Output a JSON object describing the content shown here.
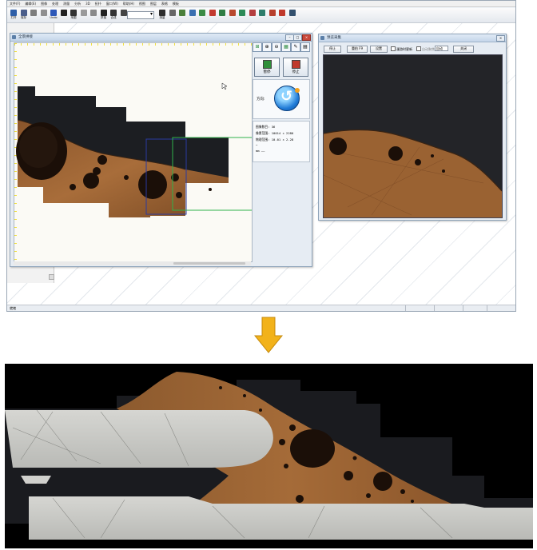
{
  "app": {
    "menu": [
      "文件(F)",
      "编辑(E)",
      "图像",
      "处理",
      "测量",
      "分析",
      "3D",
      "拓扑",
      "窗口(W)",
      "帮助(H)",
      "视图",
      "图层",
      "表格",
      "模板"
    ],
    "toolbar": [
      {
        "label": "打开",
        "icon": "open-icon",
        "color": "#2e5fa8"
      },
      {
        "label": "保存",
        "icon": "save-icon",
        "color": "#4a5d8a"
      },
      {
        "label": "",
        "icon": "copy-icon",
        "color": "#7d7d7d"
      },
      {
        "label": "",
        "icon": "paste-icon",
        "color": "#8f8f8f"
      },
      {
        "label": "Undo",
        "icon": "undo-icon",
        "color": "#2d58b8"
      },
      {
        "label": "",
        "icon": "camera-icon",
        "color": "#222222"
      },
      {
        "label": "采图",
        "icon": "capture-icon",
        "color": "#333333"
      },
      {
        "label": "",
        "icon": "scan-icon",
        "color": "#9a9a9a"
      },
      {
        "label": "",
        "icon": "tile-icon",
        "color": "#8a8a8a"
      },
      {
        "label": "拼接",
        "icon": "stitch-icon",
        "color": "#222222"
      },
      {
        "label": "合成",
        "icon": "merge-icon",
        "color": "#333333"
      },
      {
        "label": "",
        "icon": "fuse-icon",
        "color": "#444444"
      },
      {
        "label": "测量",
        "icon": "measure-icon",
        "color": "#2c2c2c"
      },
      {
        "label": "",
        "icon": "layer-icon",
        "color": "#666666"
      },
      {
        "label": "",
        "icon": "palette-icon",
        "color": "#4a7f3a"
      },
      {
        "label": "",
        "icon": "rgb-icon",
        "color": "#3a6fb0"
      },
      {
        "label": "",
        "icon": "map-icon",
        "color": "#3b8b45"
      },
      {
        "label": "",
        "icon": "chart-icon",
        "color": "#c23a2f"
      },
      {
        "label": "",
        "icon": "flag-icon",
        "color": "#2f7d44"
      },
      {
        "label": "",
        "icon": "grid-icon",
        "color": "#b8492e"
      },
      {
        "label": "",
        "icon": "note-icon",
        "color": "#2c8a57"
      },
      {
        "label": "",
        "icon": "table-icon",
        "color": "#b33e3e"
      },
      {
        "label": "",
        "icon": "pen-icon",
        "color": "#2e7d6b"
      },
      {
        "label": "",
        "icon": "tool-icon",
        "color": "#b73f2c"
      },
      {
        "label": "",
        "icon": "rainbow-icon",
        "color": "#c0392b"
      },
      {
        "label": "",
        "icon": "report-icon",
        "color": "#33506e"
      }
    ],
    "status": "就绪"
  },
  "scan_window": {
    "title": "全景拼接",
    "start_button": "暂停",
    "stop_button": "停止",
    "direction_label": "方向:",
    "info": [
      "图像数目: 36",
      "像素范围: 10014 × 2280",
      "物理范围: 10.01 × 2.28",
      "…",
      "mm  ——"
    ]
  },
  "preview_window": {
    "title": "预览采集",
    "buttons": [
      "停止",
      "重拍 F9",
      "设置",
      "关闭"
    ],
    "checkbox_auto": "漫游时更新",
    "checkbox_other": "自动聚焦",
    "mode_value": "自动"
  },
  "colors": {
    "sample_brown": "#9a6232",
    "sample_dark_brown": "#6e3f1f",
    "pore": "#1c100a",
    "metal_gray": "#c9cac6",
    "background_dark": "#141414",
    "highlight_blue": "#2a3aa0",
    "highlight_green": "#2fb24a",
    "arrow_orange": "#f2b21a"
  }
}
